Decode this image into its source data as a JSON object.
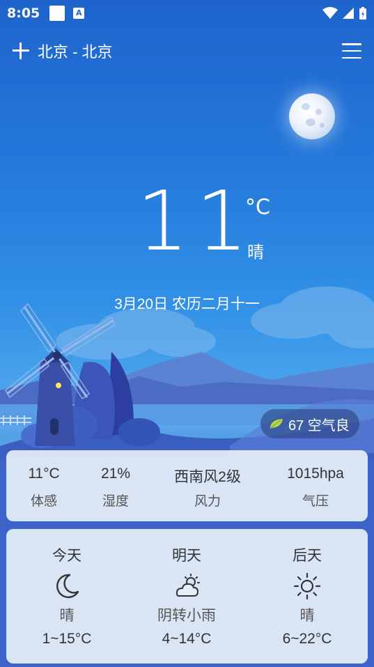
{
  "status_bar": {
    "time": "8:05"
  },
  "header": {
    "city": "北京 - 北京"
  },
  "current": {
    "temperature": "11",
    "unit": "°C",
    "condition": "晴",
    "date": "3月20日 农历二月十一"
  },
  "aqi": {
    "label": "67 空气良",
    "leaf_color": "#b4d94a"
  },
  "details": [
    {
      "value": "11°C",
      "label": "体感"
    },
    {
      "value": "21%",
      "label": "湿度"
    },
    {
      "value": "西南风2级",
      "label": "风力"
    },
    {
      "value": "1015hpa",
      "label": "气压"
    }
  ],
  "forecast": [
    {
      "day": "今天",
      "icon": "moon-icon",
      "condition": "晴",
      "range": "1~15°C"
    },
    {
      "day": "明天",
      "icon": "cloud-sun-icon",
      "condition": "阴转小雨",
      "range": "4~14°C"
    },
    {
      "day": "后天",
      "icon": "sun-icon",
      "condition": "晴",
      "range": "6~22°C"
    }
  ]
}
